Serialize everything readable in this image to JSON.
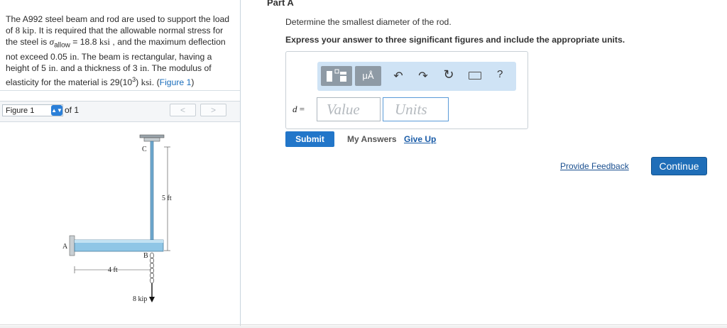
{
  "problem": {
    "text_1": "The A992 steel beam and rod are used to support the load of ",
    "load": "8 kip",
    "text_2": ". It is required that the allowable normal stress for the steel is ",
    "sigma_symbol": "σ",
    "sigma_sub": "allow",
    "stress_value": " = 18.8 ",
    "stress_unit": "ksi",
    "text_3": " , and the maximum deflection not exceed 0.05 ",
    "in_1": "in",
    "text_4": ". The beam is rectangular, having a height of 5 ",
    "in_2": "in",
    "text_5": ". and a thickness of 3 ",
    "in_3": "in",
    "text_6": ". The modulus of elasticity for the material is ",
    "modulus_base": "29(10",
    "modulus_exp": "3",
    "modulus_close": ") ",
    "modulus_unit": "ksi",
    "text_7": ". (",
    "figure_link": "Figure 1",
    "text_8": ")"
  },
  "figure_nav": {
    "selected": "Figure 1",
    "of_label": "of 1",
    "prev": "<",
    "next": ">"
  },
  "figure": {
    "label_C": "C",
    "label_A": "A",
    "label_B": "B",
    "dim_rod": "5 ft",
    "dim_beam": "4 ft",
    "load_label": "8 kip"
  },
  "part": {
    "title": "Part A",
    "question": "Determine the smallest diameter of the rod.",
    "instruction": "Express your answer to three significant figures and include the appropriate units."
  },
  "toolbar": {
    "units_label": "μÅ",
    "undo_icon": "↶",
    "redo_icon": "↷",
    "reset_icon": "↻",
    "help_label": "?"
  },
  "answer": {
    "variable": "d",
    "equals": " =",
    "value_placeholder": "Value",
    "units_placeholder": "Units"
  },
  "actions": {
    "submit": "Submit",
    "my_answers": "My Answers",
    "give_up": "Give Up",
    "provide_feedback": "Provide Feedback",
    "continue": "Continue"
  },
  "colors": {
    "primary_button": "#2276c9",
    "link": "#1a5ca8",
    "toolbar_bg": "#cfe3f5",
    "beam_fill": "#8fc6e6"
  }
}
